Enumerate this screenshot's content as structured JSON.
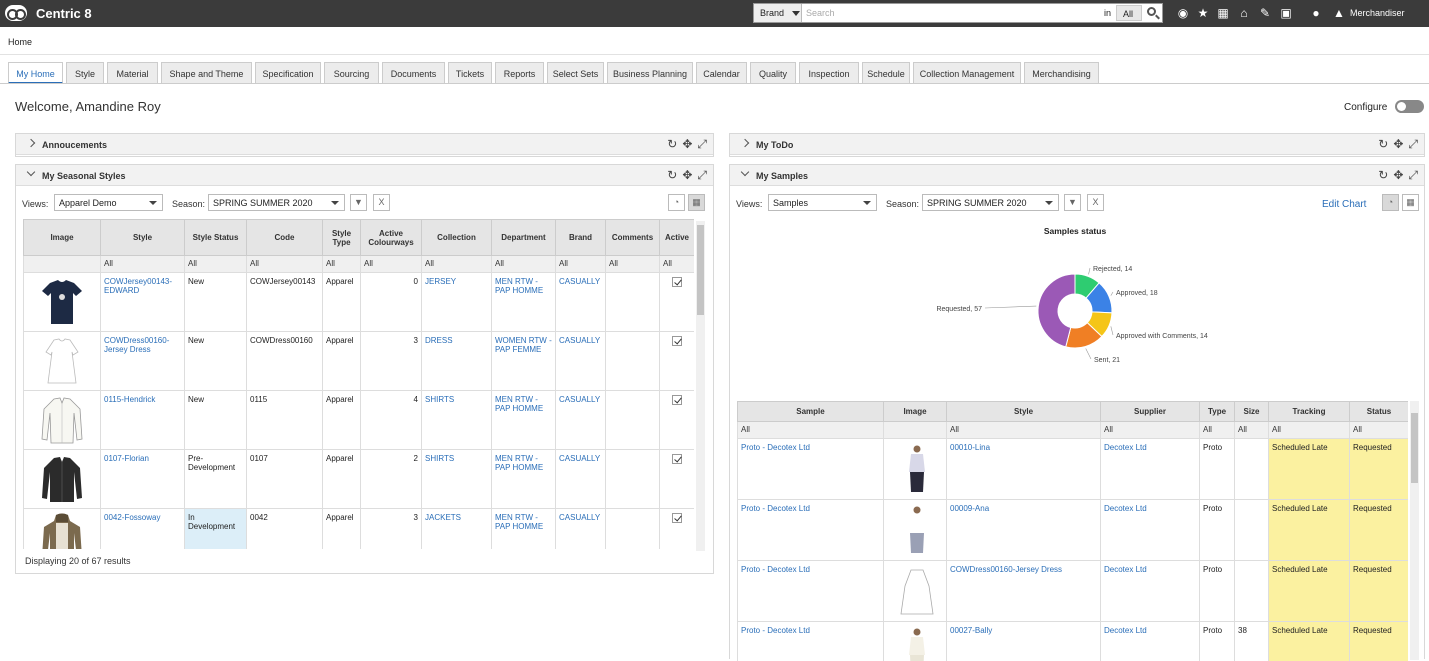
{
  "app": {
    "name": "Centric 8"
  },
  "search": {
    "scope": "Brand",
    "placeholder": "Search",
    "in_label": "in",
    "in_value": "All"
  },
  "user": {
    "name": "Merchandiser"
  },
  "breadcrumb": "Home",
  "tabs": [
    "My Home",
    "Style",
    "Material",
    "Shape and Theme",
    "Specification",
    "Sourcing",
    "Documents",
    "Tickets",
    "Reports",
    "Select Sets",
    "Business Planning",
    "Calendar",
    "Quality",
    "Inspection",
    "Schedule",
    "Collection Management",
    "Merchandising"
  ],
  "welcome": "Welcome, Amandine Roy",
  "configure_label": "Configure",
  "panels": {
    "announcements": "Annoucements",
    "todo": "My ToDo",
    "seasonal": "My Seasonal Styles",
    "samples": "My Samples"
  },
  "seasonal": {
    "views_label": "Views:",
    "views_value": "Apparel Demo",
    "season_label": "Season:",
    "season_value": "SPRING SUMMER 2020",
    "columns": [
      "Image",
      "Style",
      "Style Status",
      "Code",
      "Style Type",
      "Active Colourways",
      "Collection",
      "Department",
      "Brand",
      "Comments",
      "Active"
    ],
    "filter": [
      "",
      "All",
      "All",
      "All",
      "All",
      "All",
      "All",
      "All",
      "All",
      "All",
      "All"
    ],
    "rows": [
      {
        "style": "COWJersey00143-EDWARD",
        "status": "New",
        "code": "COWJersey00143",
        "type": "Apparel",
        "colourways": "0",
        "collection": "JERSEY",
        "department": "MEN RTW - PAP HOMME",
        "brand": "CASUALLY"
      },
      {
        "style": "COWDress00160-Jersey Dress",
        "status": "New",
        "code": "COWDress00160",
        "type": "Apparel",
        "colourways": "3",
        "collection": "DRESS",
        "department": "WOMEN RTW - PAP FEMME",
        "brand": "CASUALLY"
      },
      {
        "style": "0115-Hendrick",
        "status": "New",
        "code": "0115",
        "type": "Apparel",
        "colourways": "4",
        "collection": "SHIRTS",
        "department": "MEN RTW - PAP HOMME",
        "brand": "CASUALLY"
      },
      {
        "style": "0107-Florian",
        "status": "Pre-Development",
        "code": "0107",
        "type": "Apparel",
        "colourways": "2",
        "collection": "SHIRTS",
        "department": "MEN RTW - PAP HOMME",
        "brand": "CASUALLY"
      },
      {
        "style": "0042-Fossoway",
        "status": "In Development",
        "code": "0042",
        "type": "Apparel",
        "colourways": "3",
        "collection": "JACKETS",
        "department": "MEN RTW - PAP HOMME",
        "brand": "CASUALLY"
      }
    ],
    "footer": "Displaying 20 of 67 results"
  },
  "samples": {
    "views_label": "Views:",
    "views_value": "Samples",
    "season_label": "Season:",
    "season_value": "SPRING SUMMER 2020",
    "edit_chart": "Edit Chart",
    "columns": [
      "Sample",
      "Image",
      "Style",
      "Supplier",
      "Type",
      "Size",
      "Tracking",
      "Status"
    ],
    "filter": [
      "All",
      "",
      "All",
      "All",
      "All",
      "All",
      "All",
      "All"
    ],
    "rows": [
      {
        "sample": "Proto - Decotex Ltd",
        "style": "00010-Lina",
        "supplier": "Decotex Ltd",
        "type": "Proto",
        "size": "",
        "tracking": "Scheduled Late",
        "status": "Requested"
      },
      {
        "sample": "Proto - Decotex Ltd",
        "style": "00009-Ana",
        "supplier": "Decotex Ltd",
        "type": "Proto",
        "size": "",
        "tracking": "Scheduled Late",
        "status": "Requested"
      },
      {
        "sample": "Proto - Decotex Ltd",
        "style": "COWDress00160-Jersey Dress",
        "supplier": "Decotex Ltd",
        "type": "Proto",
        "size": "",
        "tracking": "Scheduled Late",
        "status": "Requested"
      },
      {
        "sample": "Proto - Decotex Ltd",
        "style": "00027-Bally",
        "supplier": "Decotex Ltd",
        "type": "Proto",
        "size": "38",
        "tracking": "Scheduled Late",
        "status": "Requested"
      }
    ]
  },
  "chart_data": {
    "type": "pie",
    "title": "Samples status",
    "categories": [
      "Rejected",
      "Approved",
      "Approved with Comments",
      "Sent",
      "Requested"
    ],
    "values": [
      14,
      18,
      14,
      21,
      57
    ],
    "colors": [
      "#2ecc71",
      "#3b82e6",
      "#f5c518",
      "#f07f24",
      "#9b59b6"
    ]
  }
}
